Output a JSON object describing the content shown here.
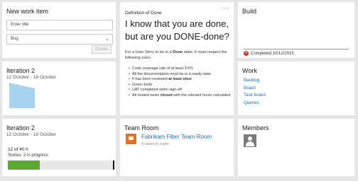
{
  "new_work_item": {
    "title": "New work item",
    "title_placeholder": "Enter title",
    "type_selected": "Bug",
    "create_label": "Create"
  },
  "definition_of_done": {
    "header": "Definition of Done",
    "menu_icon": "ellipsis-icon",
    "headline": "I know that you are done, but are you DONE-done?",
    "intro_pre": "For a User Story to be in a ",
    "intro_bold": "Done",
    "intro_post": " state, it must respect the following rules:",
    "rules": [
      {
        "pre": "Code coverage rate of at least XX%",
        "bold": "",
        "post": ""
      },
      {
        "pre": "All the documentation must be in a ready state",
        "bold": "",
        "post": ""
      },
      {
        "pre": "It has been reviewed ",
        "bold": "at least once",
        "post": ""
      },
      {
        "pre": "Green build",
        "bold": "",
        "post": ""
      },
      {
        "pre": "UAT completed withn sign-off",
        "bold": "",
        "post": ""
      },
      {
        "pre": "All related tasks ",
        "bold": "closed",
        "post": " with the relevant hours calculated"
      }
    ]
  },
  "build": {
    "title": "Build",
    "status_icon": "failed-x-icon",
    "status_text": "Completed 10/12/2015",
    "status_color": "#d0312d"
  },
  "iteration_chart": {
    "title": "Iteration 2",
    "date_range": "12 October - 18 October",
    "area_color": "#a9d3ef"
  },
  "work": {
    "title": "Work",
    "links": [
      "Backlog",
      "Board",
      "Task board",
      "Queries"
    ]
  },
  "iteration_progress": {
    "title": "Iteration 2",
    "date_range": "12 October - 18 October",
    "progress_text": "12 of 40 h",
    "stories_text": "Stories: 2 in progress",
    "completed_hours": 12,
    "total_hours": 40,
    "fill_color": "#5da831"
  },
  "team_room": {
    "title": "Team Room",
    "icon": "chat-room-icon",
    "room_name": "Fabrikam Fiber Team Room",
    "users_text": "0 users in room"
  },
  "members": {
    "title": "Members",
    "avatar_icon": "person-avatar-icon"
  }
}
